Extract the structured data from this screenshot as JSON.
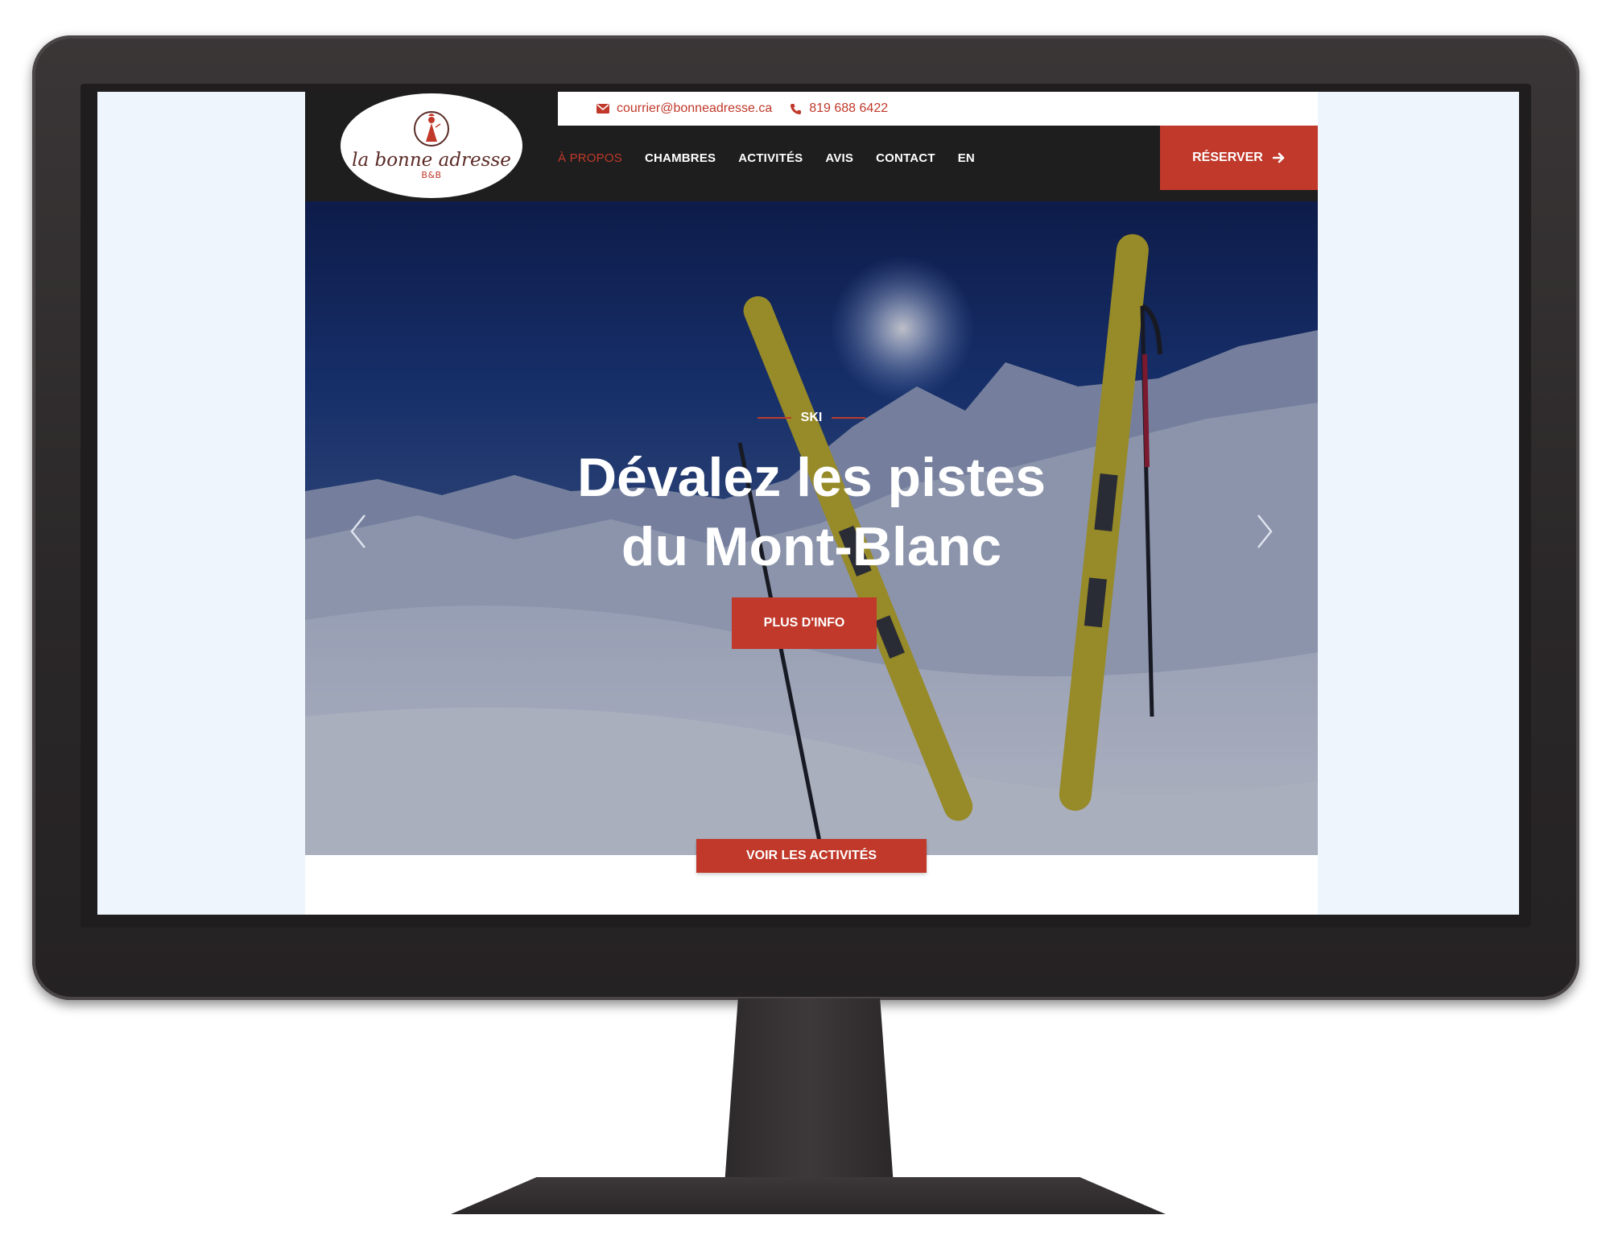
{
  "topbar": {
    "email": "courrier@bonneadresse.ca",
    "phone": "819 688 6422"
  },
  "logo": {
    "name": "la bonne adresse",
    "subtitle": "B&B"
  },
  "nav": {
    "items": [
      {
        "label": "À PROPOS",
        "active": true
      },
      {
        "label": "CHAMBRES",
        "active": false
      },
      {
        "label": "ACTIVITÉS",
        "active": false
      },
      {
        "label": "AVIS",
        "active": false
      },
      {
        "label": "CONTACT",
        "active": false
      },
      {
        "label": "EN",
        "active": false
      }
    ],
    "reserve_label": "RÉSERVER"
  },
  "hero": {
    "kicker": "SKI",
    "title_line1": "Dévalez les pistes",
    "title_line2": "du Mont-Blanc",
    "cta_label": "PLUS D'INFO",
    "prev_icon": "chevron-left-icon",
    "next_icon": "chevron-right-icon"
  },
  "activities_button": "VOIR LES ACTIVITÉS",
  "colors": {
    "accent": "#c0392b",
    "header_bg": "#1e1e1e",
    "screen_bg": "#eef5fd"
  }
}
